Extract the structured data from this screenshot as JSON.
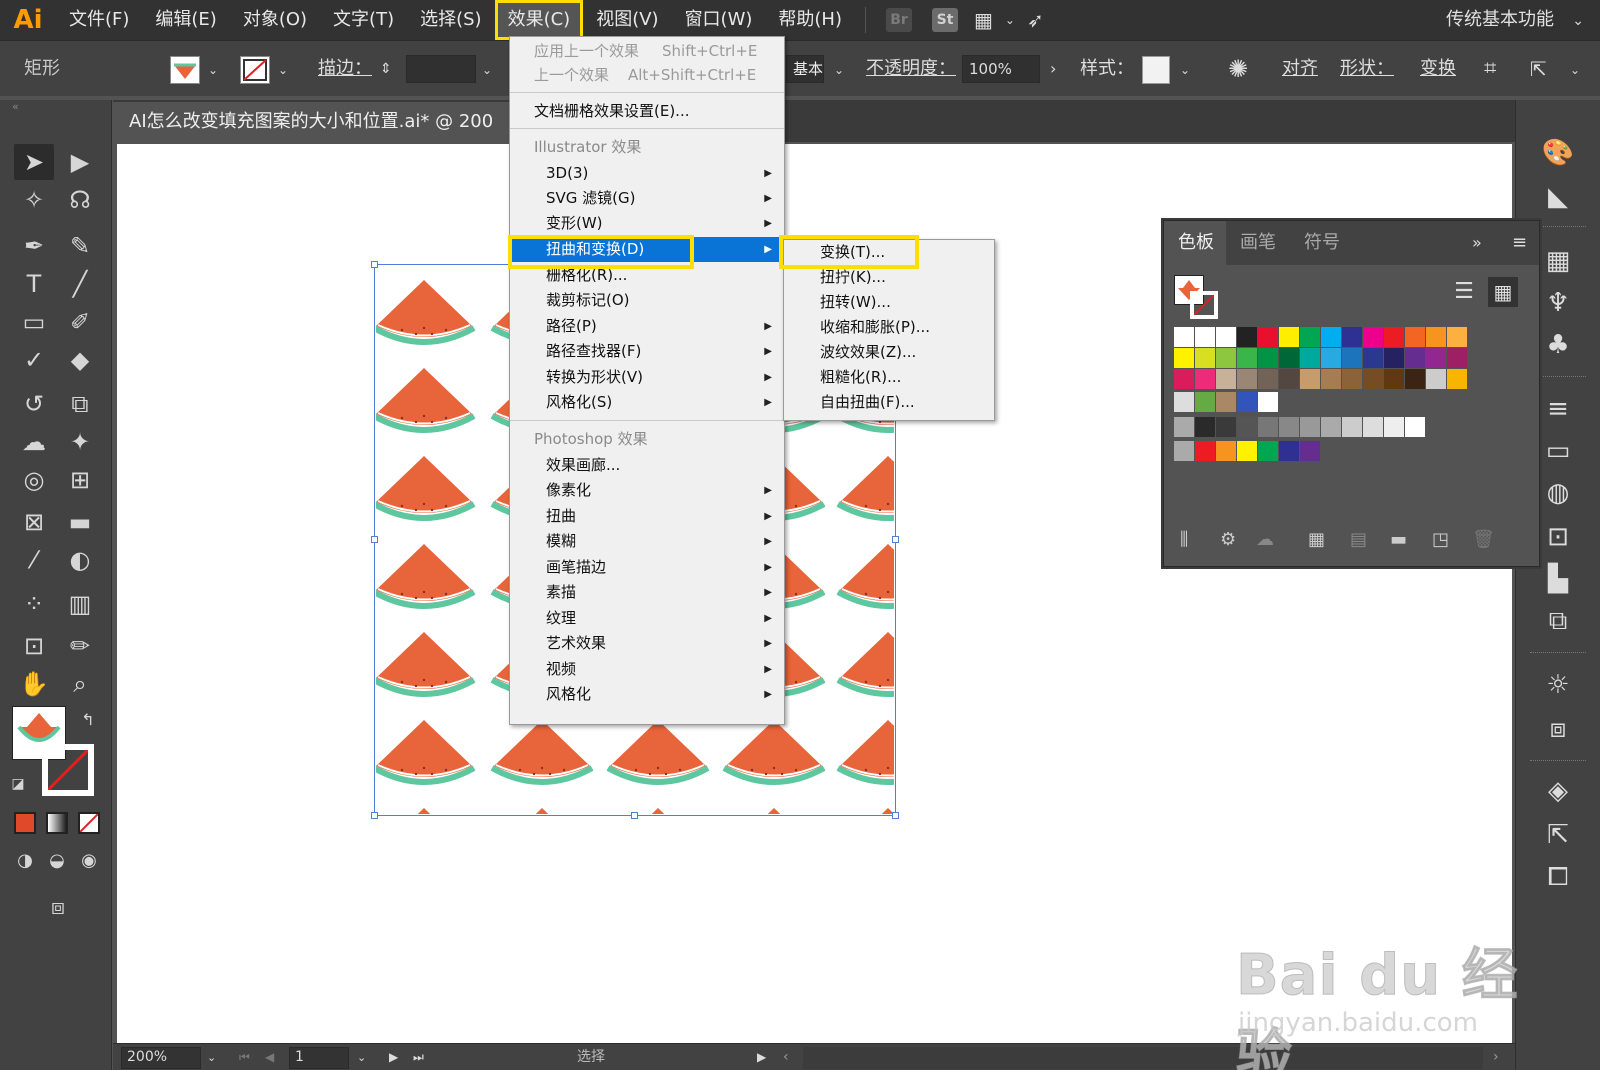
{
  "menubar": {
    "logo": "Ai",
    "items": [
      "文件(F)",
      "编辑(E)",
      "对象(O)",
      "文字(T)",
      "选择(S)",
      "效果(C)",
      "视图(V)",
      "窗口(W)",
      "帮助(H)"
    ],
    "active_item": "效果(C)",
    "badge_br": "Br",
    "badge_st": "St",
    "workspace": "传统基本功能"
  },
  "controlbar": {
    "object_type": "矩形",
    "stroke_label": "描边：",
    "basic_label": "基本",
    "opacity_label": "不透明度：",
    "opacity_value": "100%",
    "style_label": "样式：",
    "align_label": "对齐",
    "shape_label": "形状：",
    "transform_label": "变换"
  },
  "document": {
    "tab_title": "AI怎么改变填充图案的大小和位置.ai* @ 200"
  },
  "statusbar": {
    "zoom": "200%",
    "artboard": "1",
    "tool_status": "选择"
  },
  "effect_menu": {
    "apply_last": "应用上一个效果",
    "apply_last_shortcut": "Shift+Ctrl+E",
    "last_effect": "上一个效果",
    "last_effect_shortcut": "Alt+Shift+Ctrl+E",
    "raster_settings": "文档栅格效果设置(E)...",
    "illustrator_header": "Illustrator 效果",
    "illustrator_items": [
      "3D(3)",
      "SVG 滤镜(G)",
      "变形(W)",
      "扭曲和变换(D)",
      "栅格化(R)...",
      "裁剪标记(O)",
      "路径(P)",
      "路径查找器(F)",
      "转换为形状(V)",
      "风格化(S)"
    ],
    "photoshop_header": "Photoshop 效果",
    "photoshop_items": [
      "效果画廊...",
      "像素化",
      "扭曲",
      "模糊",
      "画笔描边",
      "素描",
      "纹理",
      "艺术效果",
      "视频",
      "风格化"
    ],
    "highlighted": "扭曲和变换(D)"
  },
  "submenu": {
    "items": [
      "变换(T)...",
      "扭拧(K)...",
      "扭转(W)...",
      "收缩和膨胀(P)...",
      "波纹效果(Z)...",
      "粗糙化(R)...",
      "自由扭曲(F)..."
    ],
    "highlighted": "变换(T)..."
  },
  "swatch_panel": {
    "tabs": [
      "色板",
      "画笔",
      "符号"
    ],
    "active_tab": "色板"
  },
  "watermark": {
    "main": "Bai du 经验",
    "sub": "jingyan.baidu.com"
  },
  "colors": {
    "highlight_blue": "#0a74d6",
    "callout_yellow": "#ffde00",
    "watermelon_flesh": "#e8643a",
    "watermelon_rind": "#5ec7a0",
    "ai_orange": "#ff9a00"
  }
}
